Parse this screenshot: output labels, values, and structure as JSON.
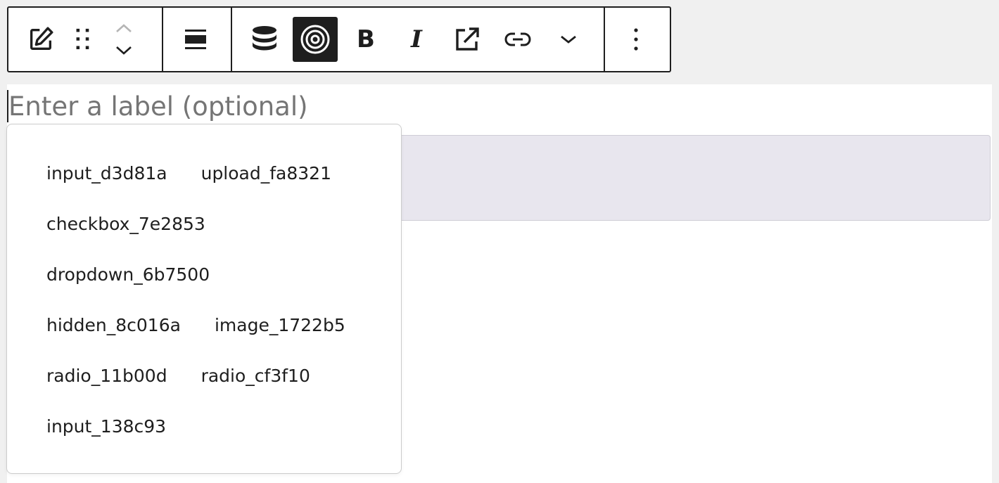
{
  "toolbar": {
    "groups": [
      {
        "icons": [
          "edit-icon",
          "drag-handle-icon",
          "move-up-icon",
          "move-down-icon"
        ]
      },
      {
        "icons": [
          "align-icon"
        ]
      },
      {
        "icons": [
          "database-icon",
          "target-icon",
          "bold-icon",
          "italic-icon",
          "open-external-icon",
          "link-icon",
          "chevron-down-icon"
        ]
      },
      {
        "icons": [
          "more-options-icon"
        ]
      }
    ],
    "bold_label": "B",
    "italic_label": "I",
    "active_tool": "target-icon"
  },
  "editor": {
    "label_placeholder": "Enter a label (optional)",
    "field_box_color": "#e8e6ee"
  },
  "popover": {
    "rows": [
      [
        "input_d3d81a",
        "upload_fa8321"
      ],
      [
        "checkbox_7e2853"
      ],
      [
        "dropdown_6b7500"
      ],
      [
        "hidden_8c016a",
        "image_1722b5"
      ],
      [
        "radio_11b00d",
        "radio_cf3f10"
      ],
      [
        "input_138c93"
      ]
    ]
  },
  "colors": {
    "ink": "#1e1e1e",
    "placeholder": "#757575",
    "page_bg": "#f0f0f0"
  }
}
